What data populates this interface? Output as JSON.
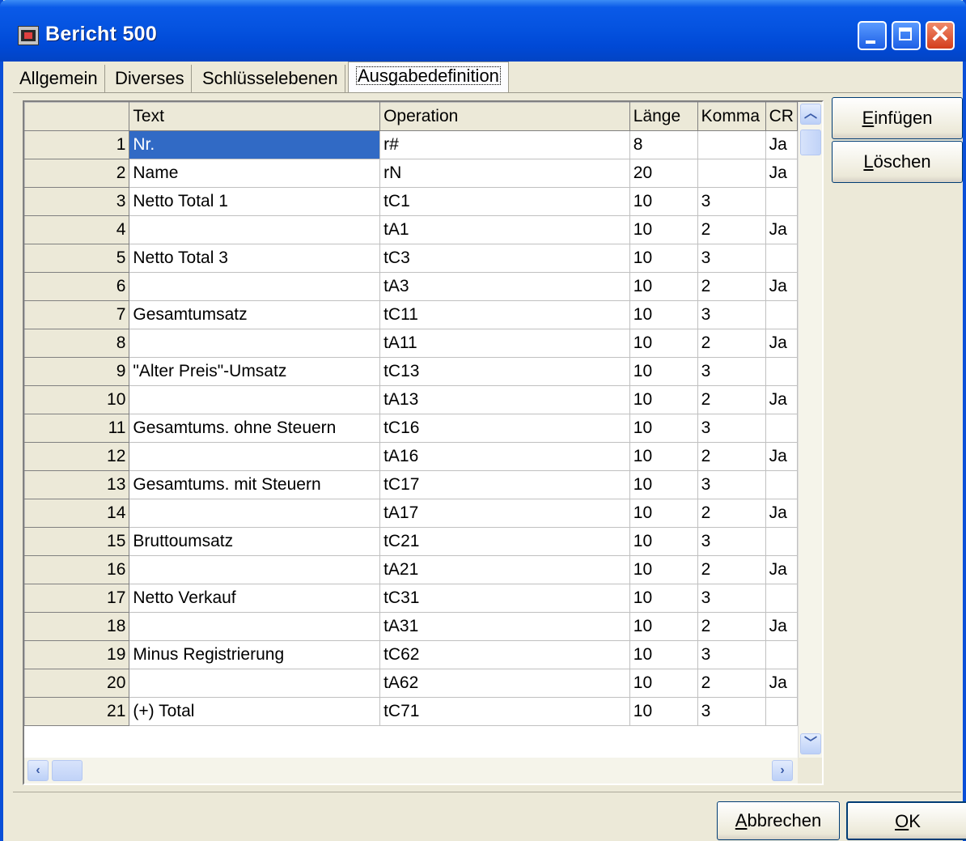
{
  "window": {
    "title": "Bericht 500"
  },
  "tabs": [
    {
      "label": "Allgemein"
    },
    {
      "label": "Diverses"
    },
    {
      "label": "Schlüsselebenen"
    },
    {
      "label": "Ausgabedefinition"
    }
  ],
  "grid": {
    "headers": {
      "num": "",
      "text": "Text",
      "operation": "Operation",
      "laenge": "Länge",
      "komma": "Komma",
      "cr": "CR"
    },
    "rows": [
      {
        "num": "1",
        "text": "Nr.",
        "operation": "r#",
        "laenge": "8",
        "komma": "",
        "cr": "Ja"
      },
      {
        "num": "2",
        "text": "Name",
        "operation": "rN",
        "laenge": "20",
        "komma": "",
        "cr": "Ja"
      },
      {
        "num": "3",
        "text": "Netto Total 1",
        "operation": "tC1",
        "laenge": "10",
        "komma": "3",
        "cr": ""
      },
      {
        "num": "4",
        "text": "",
        "operation": "tA1",
        "laenge": "10",
        "komma": "2",
        "cr": "Ja"
      },
      {
        "num": "5",
        "text": "Netto Total 3",
        "operation": "tC3",
        "laenge": "10",
        "komma": "3",
        "cr": ""
      },
      {
        "num": "6",
        "text": "",
        "operation": "tA3",
        "laenge": "10",
        "komma": "2",
        "cr": "Ja"
      },
      {
        "num": "7",
        "text": "Gesamtumsatz",
        "operation": "tC11",
        "laenge": "10",
        "komma": "3",
        "cr": ""
      },
      {
        "num": "8",
        "text": "",
        "operation": "tA11",
        "laenge": "10",
        "komma": "2",
        "cr": "Ja"
      },
      {
        "num": "9",
        "text": "\"Alter Preis\"-Umsatz",
        "operation": "tC13",
        "laenge": "10",
        "komma": "3",
        "cr": ""
      },
      {
        "num": "10",
        "text": "",
        "operation": "tA13",
        "laenge": "10",
        "komma": "2",
        "cr": "Ja"
      },
      {
        "num": "11",
        "text": "Gesamtums. ohne Steuern",
        "operation": "tC16",
        "laenge": "10",
        "komma": "3",
        "cr": ""
      },
      {
        "num": "12",
        "text": "",
        "operation": "tA16",
        "laenge": "10",
        "komma": "2",
        "cr": "Ja"
      },
      {
        "num": "13",
        "text": "Gesamtums. mit Steuern",
        "operation": "tC17",
        "laenge": "10",
        "komma": "3",
        "cr": ""
      },
      {
        "num": "14",
        "text": "",
        "operation": "tA17",
        "laenge": "10",
        "komma": "2",
        "cr": "Ja"
      },
      {
        "num": "15",
        "text": "Bruttoumsatz",
        "operation": "tC21",
        "laenge": "10",
        "komma": "3",
        "cr": ""
      },
      {
        "num": "16",
        "text": "",
        "operation": "tA21",
        "laenge": "10",
        "komma": "2",
        "cr": "Ja"
      },
      {
        "num": "17",
        "text": "Netto Verkauf",
        "operation": "tC31",
        "laenge": "10",
        "komma": "3",
        "cr": ""
      },
      {
        "num": "18",
        "text": "",
        "operation": "tA31",
        "laenge": "10",
        "komma": "2",
        "cr": "Ja"
      },
      {
        "num": "19",
        "text": "Minus Registrierung",
        "operation": "tC62",
        "laenge": "10",
        "komma": "3",
        "cr": ""
      },
      {
        "num": "20",
        "text": "",
        "operation": "tA62",
        "laenge": "10",
        "komma": "2",
        "cr": "Ja"
      },
      {
        "num": "21",
        "text": "(+) Total",
        "operation": "tC71",
        "laenge": "10",
        "komma": "3",
        "cr": ""
      }
    ],
    "selected_row": 1
  },
  "buttons": {
    "einfuegen_first": "E",
    "einfuegen_rest": "infügen",
    "loeschen_first": "L",
    "loeschen_rest": "öschen",
    "abbrechen_first": "A",
    "abbrechen_rest": "bbrechen",
    "ok_first": "O",
    "ok_rest": "K"
  },
  "icons": {
    "app": "report-window-icon",
    "minimize": "minimize-icon",
    "maximize": "maximize-icon",
    "close": "close-icon"
  }
}
